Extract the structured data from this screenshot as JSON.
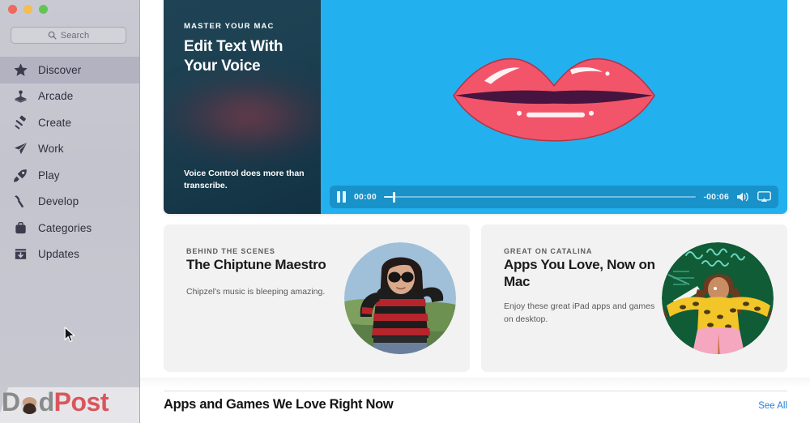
{
  "window": {
    "traffic_lights": [
      "close",
      "minimize",
      "maximize"
    ],
    "colors": {
      "close": "#ec6a5e",
      "minimize": "#f4bd4f",
      "maximize": "#61c554",
      "sidebar_bg": "#c6c6d0",
      "sidebar_selected": "#b2b2c0",
      "hero_cyan": "#23b0ef",
      "hero_dark": "#1e4354",
      "lips_red": "#f2556a",
      "link_blue": "#2a7fd4",
      "card_bg": "#f2f2f2"
    }
  },
  "search": {
    "placeholder": "Search",
    "value": "",
    "icon": "search-icon"
  },
  "sidebar": {
    "items": [
      {
        "label": "Discover",
        "icon": "star-icon",
        "selected": true
      },
      {
        "label": "Arcade",
        "icon": "arcade-icon",
        "selected": false
      },
      {
        "label": "Create",
        "icon": "gavel-icon",
        "selected": false
      },
      {
        "label": "Work",
        "icon": "paperplane-icon",
        "selected": false
      },
      {
        "label": "Play",
        "icon": "rocket-icon",
        "selected": false
      },
      {
        "label": "Develop",
        "icon": "hammer-icon",
        "selected": false
      },
      {
        "label": "Categories",
        "icon": "briefcase-icon",
        "selected": false
      },
      {
        "label": "Updates",
        "icon": "download-icon",
        "selected": false
      }
    ]
  },
  "hero": {
    "eyebrow": "MASTER YOUR MAC",
    "title": "Edit Text With Your Voice",
    "subtitle": "Voice Control does more than transcribe.",
    "artwork": "lips-illustration",
    "player": {
      "state": "playing",
      "pause_icon": "pause-icon",
      "elapsed": "00:00",
      "remaining": "-00:06",
      "progress_percent": 3,
      "volume_icon": "volume-icon",
      "airplay_icon": "airplay-icon"
    }
  },
  "cards": [
    {
      "eyebrow": "BEHIND THE SCENES",
      "title": "The Chiptune Maestro",
      "subtitle": "Chipzel's music is bleeping amazing.",
      "image": "chipzel-portrait-photo"
    },
    {
      "eyebrow": "GREAT ON CATALINA",
      "title": "Apps You Love, Now on Mac",
      "subtitle": "Enjoy these great iPad apps and games on desktop.",
      "image": "ipad-apps-illustration"
    }
  ],
  "section": {
    "title": "Apps and Games We Love Right Now",
    "see_all": "See All"
  },
  "watermark": {
    "text_prefix": "D",
    "text_middle": "d",
    "text_suffix": "Post",
    "full_text": "DadPost"
  }
}
